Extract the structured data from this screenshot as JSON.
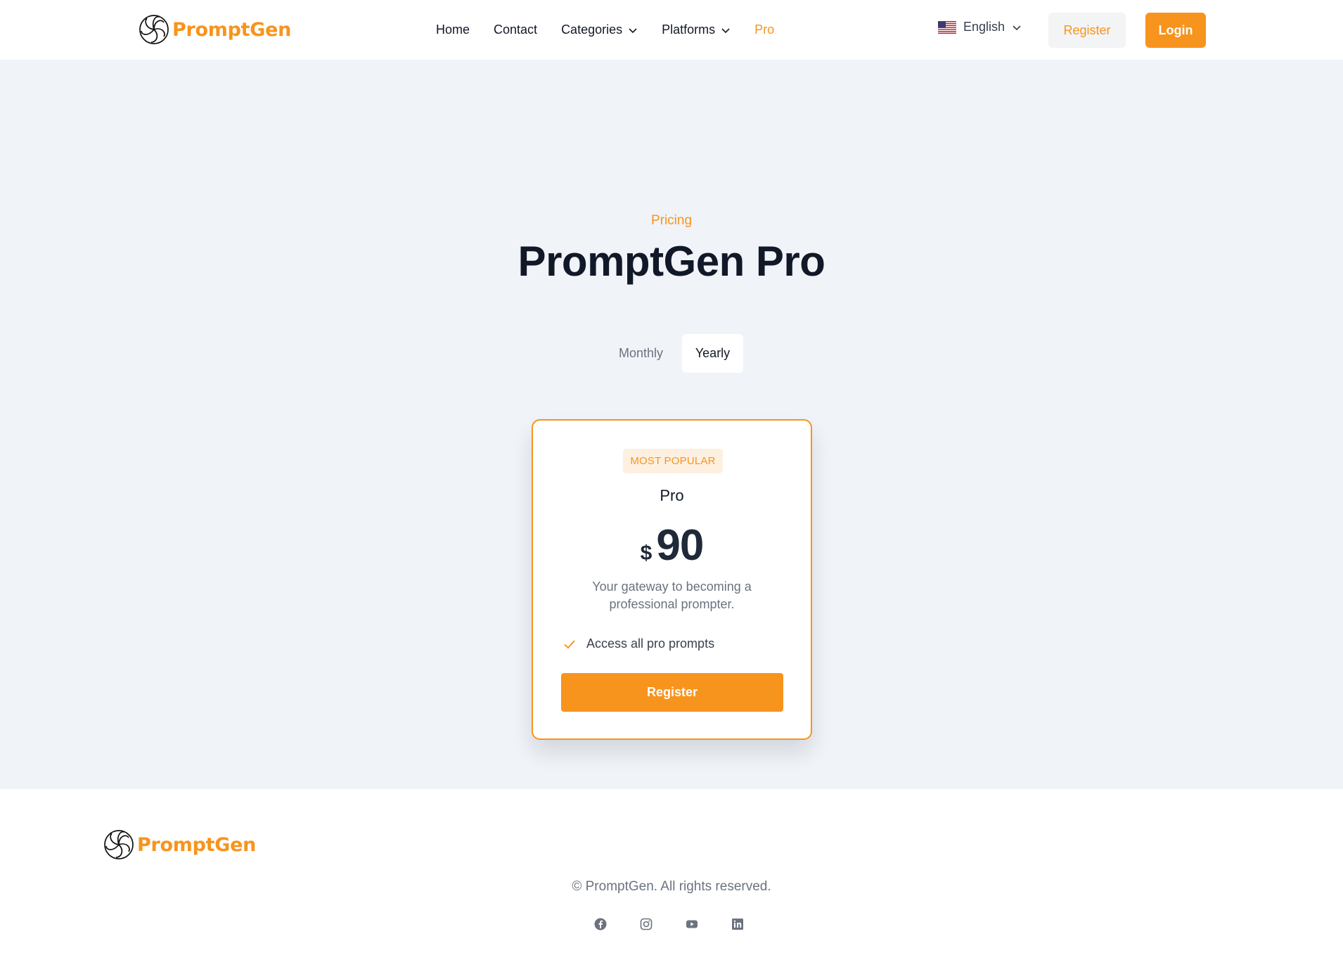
{
  "brand": {
    "name": "PromptGen",
    "accent": "#f7941d"
  },
  "nav": {
    "items": [
      {
        "label": "Home"
      },
      {
        "label": "Contact"
      },
      {
        "label": "Categories"
      },
      {
        "label": "Platforms"
      },
      {
        "label": "Pro"
      }
    ]
  },
  "language": {
    "label": "English",
    "flag_icon": "us-flag-icon"
  },
  "header_actions": {
    "register_label": "Register",
    "login_label": "Login"
  },
  "hero": {
    "eyebrow": "Pricing",
    "title": "PromptGen Pro"
  },
  "billing_toggle": {
    "monthly_label": "Monthly",
    "yearly_label": "Yearly",
    "selected": "Yearly"
  },
  "plan": {
    "badge": "MOST POPULAR",
    "name": "Pro",
    "currency": "$",
    "price": "90",
    "description": "Your gateway to becoming a professional prompter.",
    "features": [
      "Access all pro prompts"
    ],
    "cta_label": "Register"
  },
  "footer": {
    "copyright": "© PromptGen. All rights reserved.",
    "socials": [
      "facebook-icon",
      "instagram-icon",
      "youtube-icon",
      "linkedin-icon"
    ]
  }
}
